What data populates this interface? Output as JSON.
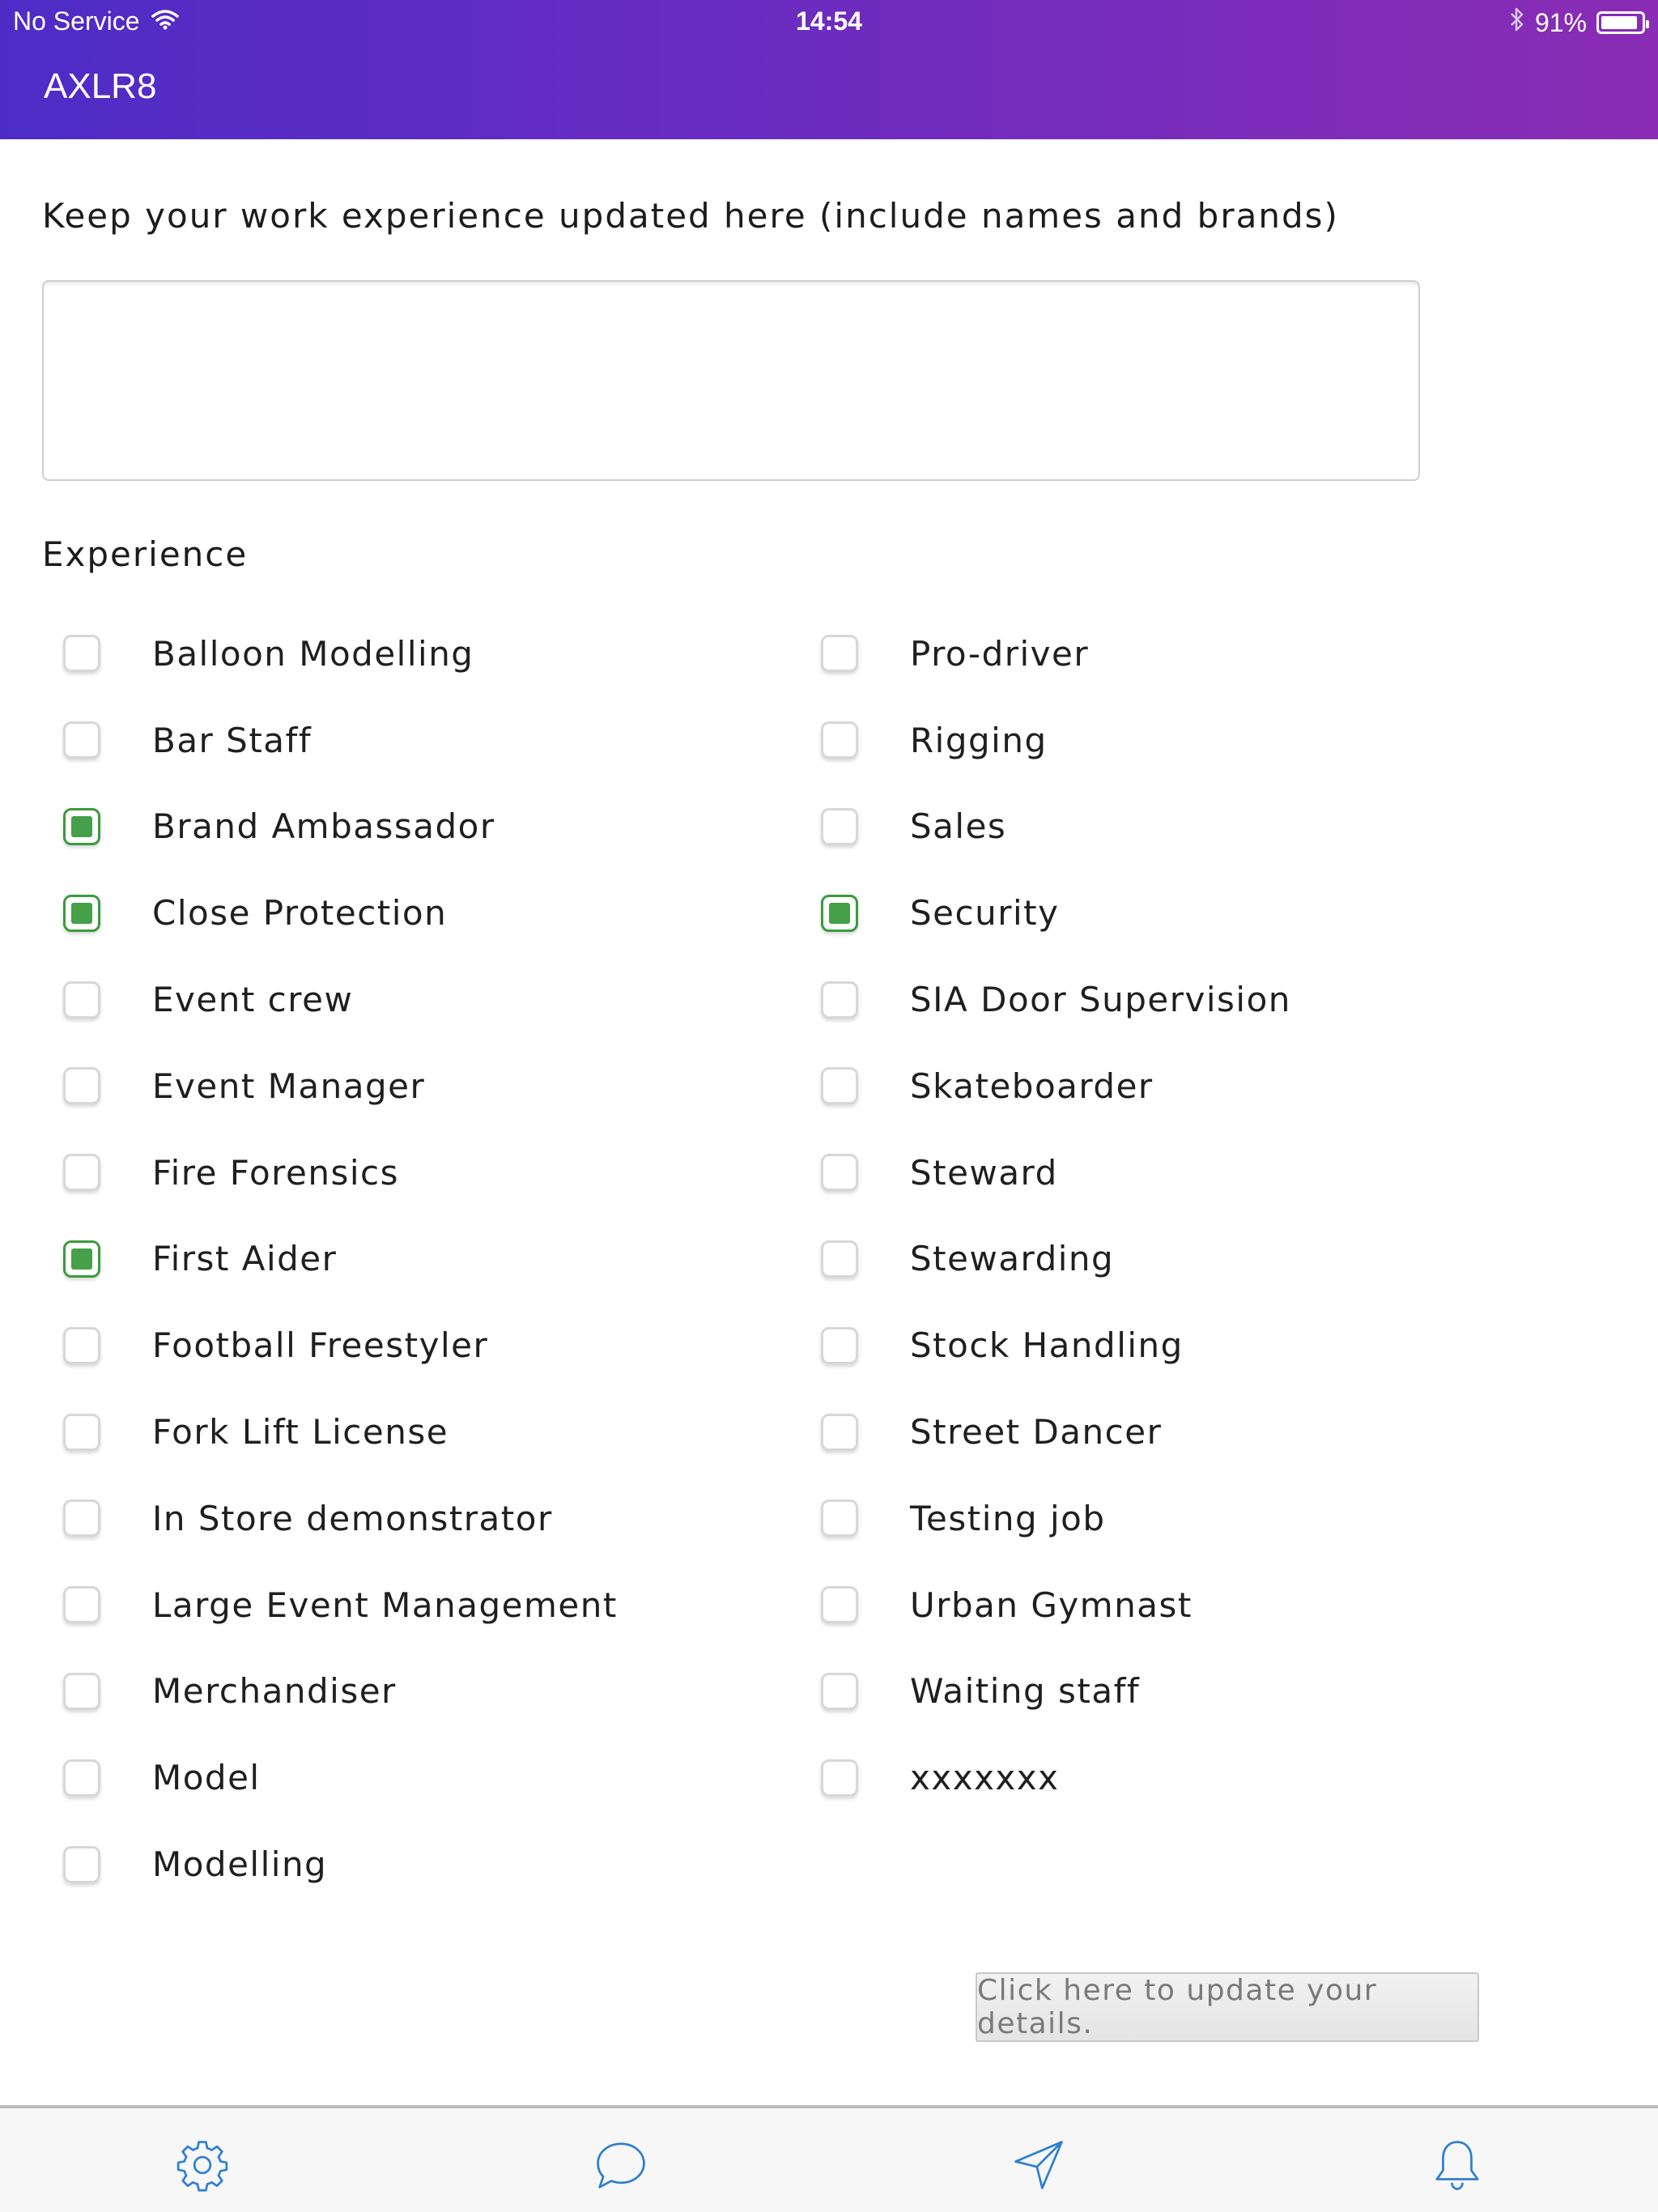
{
  "status_bar": {
    "carrier": "No Service",
    "time": "14:54",
    "battery": "91%",
    "battery_level": 0.91
  },
  "app": {
    "title": "AXLR8"
  },
  "form": {
    "intro_label": "Keep your work experience updated here (include names and brands)",
    "experience_text": "",
    "section_heading": "Experience",
    "options": [
      {
        "label": "Balloon Modelling",
        "checked": false
      },
      {
        "label": "Bar Staff",
        "checked": false
      },
      {
        "label": "Brand Ambassador",
        "checked": true
      },
      {
        "label": "Close Protection",
        "checked": true
      },
      {
        "label": "Event crew",
        "checked": false
      },
      {
        "label": "Event Manager",
        "checked": false
      },
      {
        "label": "Fire Forensics",
        "checked": false
      },
      {
        "label": "First Aider",
        "checked": true
      },
      {
        "label": "Football Freestyler",
        "checked": false
      },
      {
        "label": "Fork Lift License",
        "checked": false
      },
      {
        "label": "In Store demonstrator",
        "checked": false
      },
      {
        "label": "Large Event Management",
        "checked": false
      },
      {
        "label": "Merchandiser",
        "checked": false
      },
      {
        "label": "Model",
        "checked": false
      },
      {
        "label": "Modelling",
        "checked": false
      },
      {
        "label": "Pro-driver",
        "checked": false
      },
      {
        "label": "Rigging",
        "checked": false
      },
      {
        "label": "Sales",
        "checked": false
      },
      {
        "label": "Security",
        "checked": true
      },
      {
        "label": "SIA Door Supervision",
        "checked": false
      },
      {
        "label": "Skateboarder",
        "checked": false
      },
      {
        "label": "Steward",
        "checked": false
      },
      {
        "label": "Stewarding",
        "checked": false
      },
      {
        "label": "Stock Handling",
        "checked": false
      },
      {
        "label": "Street Dancer",
        "checked": false
      },
      {
        "label": "Testing job",
        "checked": false
      },
      {
        "label": "Urban Gymnast",
        "checked": false
      },
      {
        "label": "Waiting staff",
        "checked": false
      },
      {
        "label": "xxxxxxx",
        "checked": false
      }
    ],
    "update_button": "Click here to update your details."
  },
  "tab_bar": {
    "tabs": [
      {
        "icon": "gear-icon"
      },
      {
        "icon": "chat-bubble-icon"
      },
      {
        "icon": "send-icon"
      },
      {
        "icon": "bell-icon"
      }
    ],
    "icon_color": "#2f7fd0"
  },
  "colors": {
    "header_gradient_start": "#4d2cc6",
    "header_gradient_end": "#8a2cb4",
    "checkbox_checked": "#45a049"
  }
}
